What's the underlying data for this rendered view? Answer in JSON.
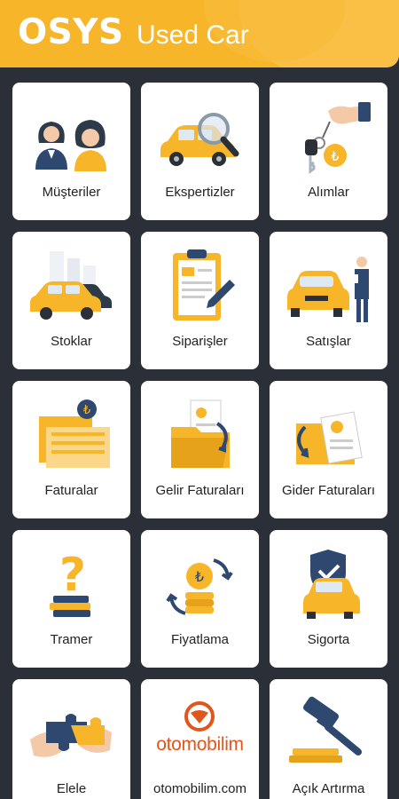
{
  "header": {
    "brand": "OSYS",
    "subtitle": "Used Car"
  },
  "colors": {
    "accent": "#f7b52a",
    "background": "#2b2f38",
    "tile": "#ffffff"
  },
  "tiles": [
    {
      "label": "Müşteriler",
      "icon": "customers-icon"
    },
    {
      "label": "Ekspertizler",
      "icon": "car-inspection-icon"
    },
    {
      "label": "Alımlar",
      "icon": "car-keys-icon"
    },
    {
      "label": "Stoklar",
      "icon": "car-stock-icon"
    },
    {
      "label": "Siparişler",
      "icon": "order-clipboard-icon"
    },
    {
      "label": "Satışlar",
      "icon": "car-salesman-icon"
    },
    {
      "label": "Faturalar",
      "icon": "invoices-icon"
    },
    {
      "label": "Gelir Faturaları",
      "icon": "income-folder-icon"
    },
    {
      "label": "Gider Faturaları",
      "icon": "expense-folder-icon"
    },
    {
      "label": "Tramer",
      "icon": "question-books-icon"
    },
    {
      "label": "Fiyatlama",
      "icon": "pricing-coins-icon"
    },
    {
      "label": "Sigorta",
      "icon": "insurance-shield-icon"
    },
    {
      "label": "Elele",
      "icon": "puzzle-hands-icon"
    },
    {
      "label": "otomobilim.com",
      "icon": "otomobilim-logo-icon",
      "logo_text": "otomobilim"
    },
    {
      "label": "Açık Artırma",
      "icon": "auction-gavel-icon"
    }
  ]
}
